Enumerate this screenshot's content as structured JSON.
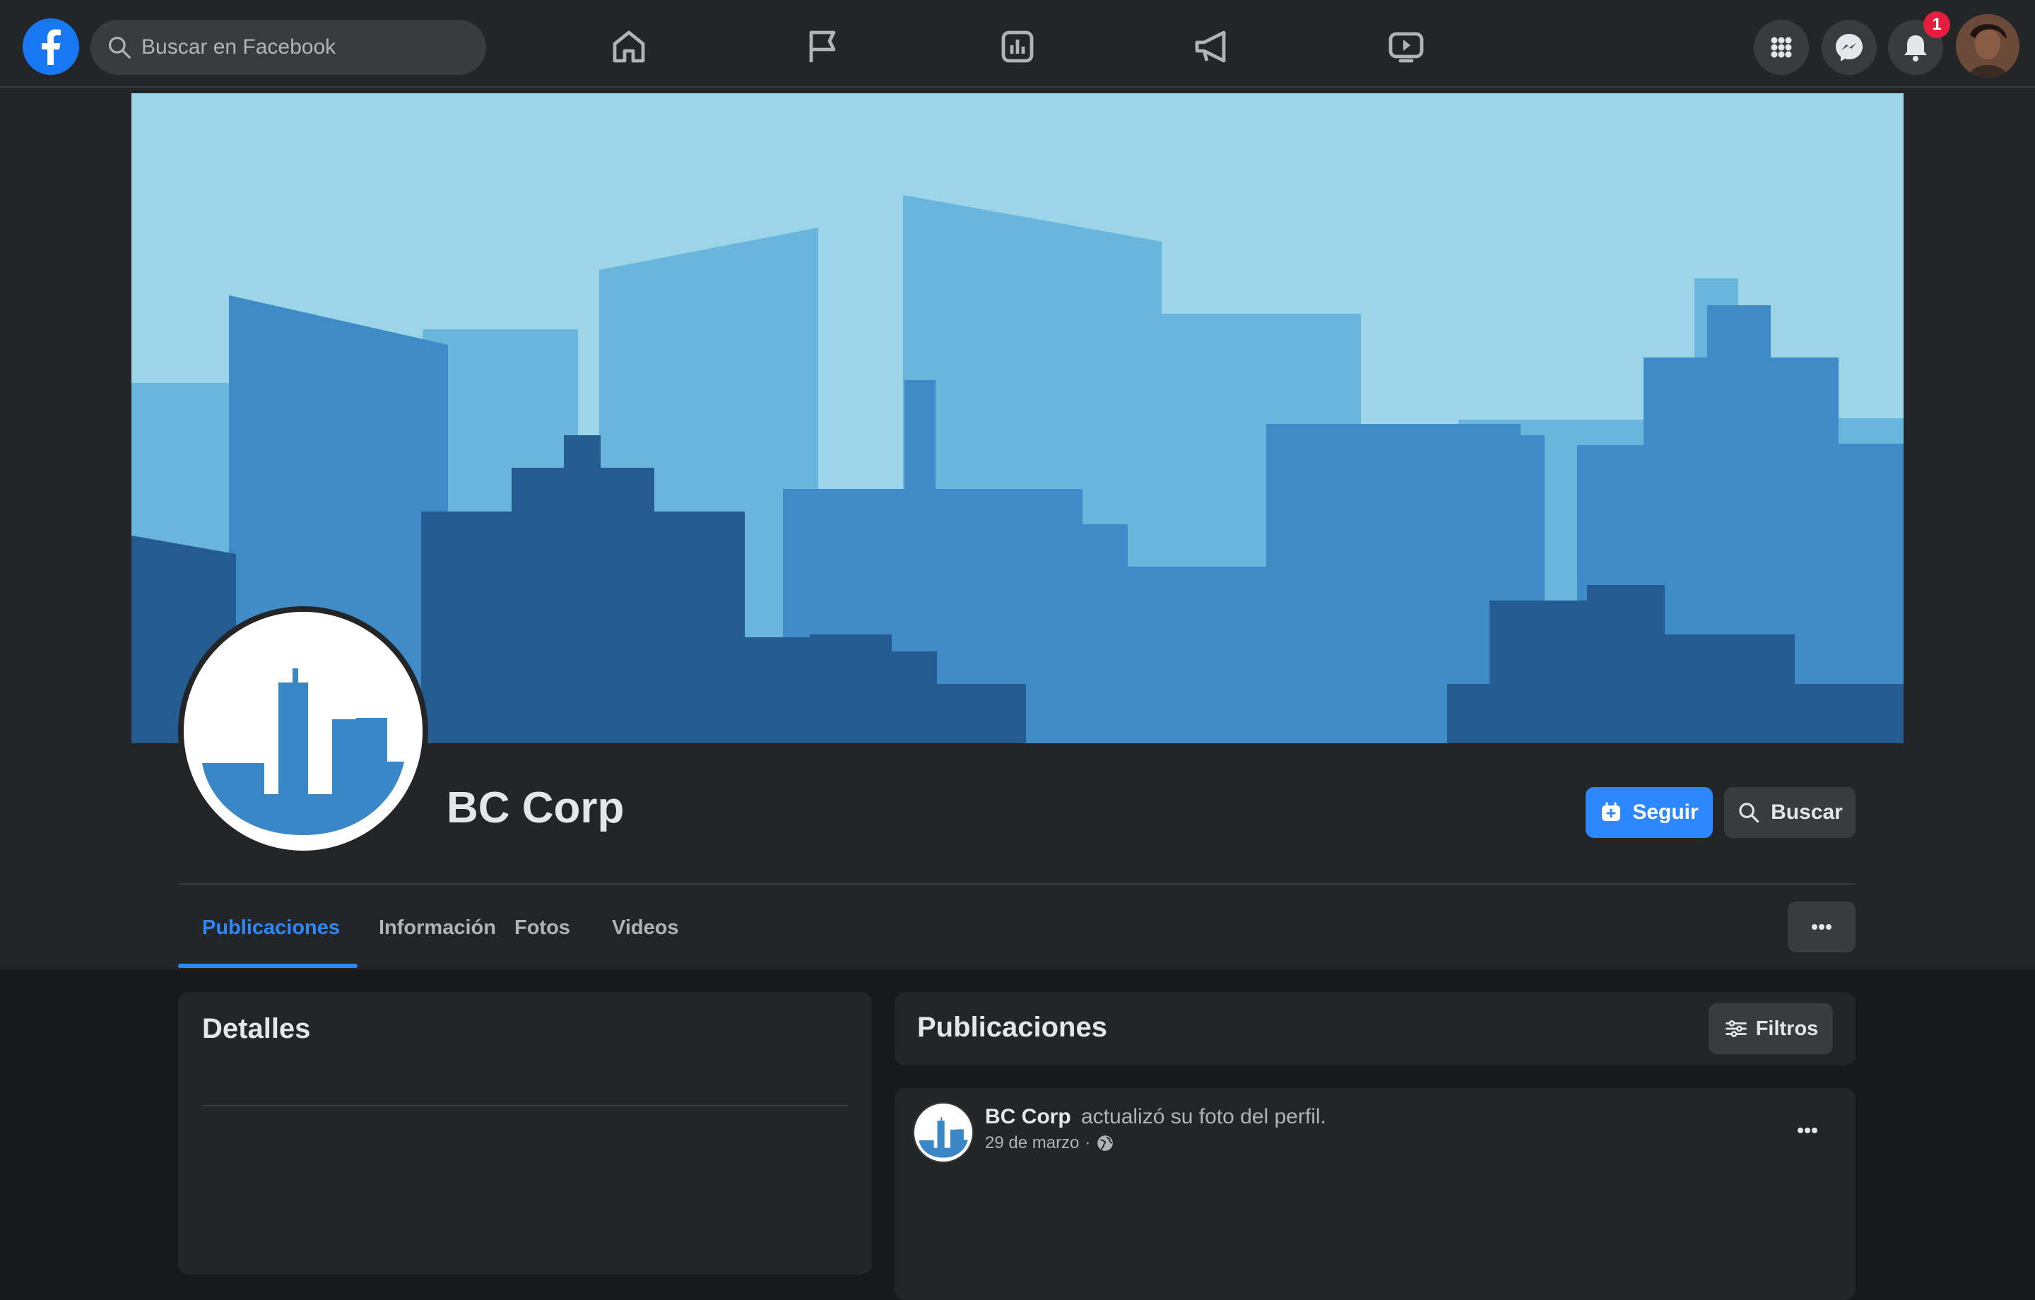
{
  "topbar": {
    "search_placeholder": "Buscar en Facebook",
    "nav_icons": [
      "home-icon",
      "flag-icon",
      "insights-icon",
      "megaphone-icon",
      "watch-icon"
    ],
    "right_icons": [
      "grid-menu-icon",
      "messenger-icon",
      "bell-icon"
    ],
    "notification_count": "1"
  },
  "page": {
    "name": "BC Corp",
    "follow_label": "Seguir",
    "search_label": "Buscar",
    "more_label": "•••"
  },
  "tabs": [
    {
      "label": "Publicaciones",
      "active": true
    },
    {
      "label": "Información",
      "active": false
    },
    {
      "label": "Fotos",
      "active": false
    },
    {
      "label": "Videos",
      "active": false
    }
  ],
  "details": {
    "title": "Detalles"
  },
  "posts": {
    "title": "Publicaciones",
    "filter_label": "Filtros",
    "items": [
      {
        "author": "BC Corp",
        "action": "actualizó su foto del perfil.",
        "date": "29 de marzo",
        "privacy_icon": "globe-icon",
        "more_label": "•••"
      }
    ]
  },
  "colors": {
    "accent": "#2d88ff",
    "brand": "#1877f2",
    "badge": "#e41e3f",
    "background": "#18191a",
    "surface": "#242526"
  }
}
